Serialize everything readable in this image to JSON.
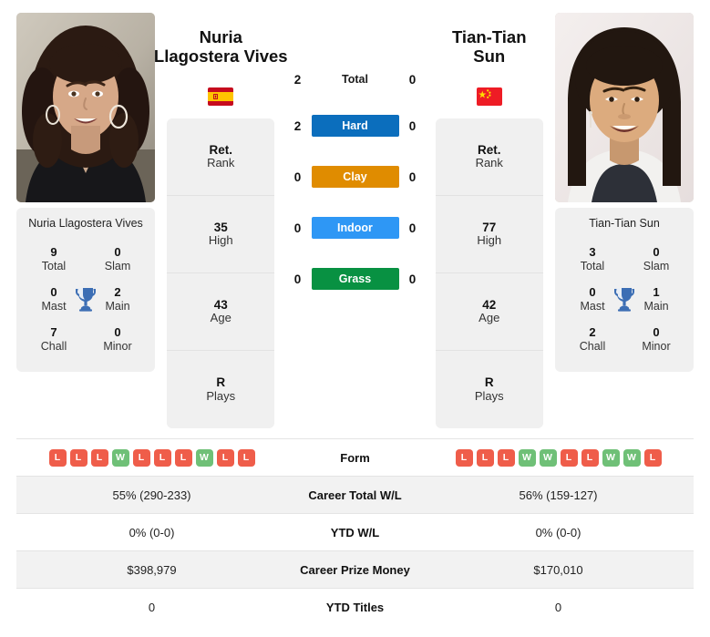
{
  "colors": {
    "hard": "#0b6ebd",
    "clay": "#e08c00",
    "indoor": "#2e97f5",
    "grass": "#089142",
    "win": "#6fc077",
    "loss": "#ef5d4a",
    "card_bg": "#f0f0f0",
    "row_shade": "#f2f2f2",
    "trophy": "#3c6eb4"
  },
  "players": {
    "left": {
      "photo_alt": "Nuria Llagostera Vives headshot",
      "name_line1": "Nuria",
      "name_line2": "Llagostera Vives",
      "flag": "spain-flag",
      "card_name": "Nuria Llagostera Vives",
      "rank": {
        "value": "Ret.",
        "label": "Rank"
      },
      "high": {
        "value": "35",
        "label": "High"
      },
      "age": {
        "value": "43",
        "label": "Age"
      },
      "plays": {
        "value": "R",
        "label": "Plays"
      },
      "titles": {
        "total": {
          "value": "9",
          "label": "Total"
        },
        "slam": {
          "value": "0",
          "label": "Slam"
        },
        "mast": {
          "value": "0",
          "label": "Mast"
        },
        "main": {
          "value": "2",
          "label": "Main"
        },
        "chall": {
          "value": "7",
          "label": "Chall"
        },
        "minor": {
          "value": "0",
          "label": "Minor"
        }
      },
      "surface_wins": {
        "total": "2",
        "hard": "2",
        "clay": "0",
        "indoor": "0",
        "grass": "0"
      },
      "form": [
        "L",
        "L",
        "L",
        "W",
        "L",
        "L",
        "L",
        "W",
        "L",
        "L"
      ],
      "career_total_wl": "55% (290-233)",
      "ytd_wl": "0% (0-0)",
      "career_prize_money": "$398,979",
      "ytd_titles": "0"
    },
    "right": {
      "photo_alt": "Tian-Tian Sun headshot",
      "name_line1": "Tian-Tian",
      "name_line2": "Sun",
      "flag": "china-flag",
      "card_name": "Tian-Tian Sun",
      "rank": {
        "value": "Ret.",
        "label": "Rank"
      },
      "high": {
        "value": "77",
        "label": "High"
      },
      "age": {
        "value": "42",
        "label": "Age"
      },
      "plays": {
        "value": "R",
        "label": "Plays"
      },
      "titles": {
        "total": {
          "value": "3",
          "label": "Total"
        },
        "slam": {
          "value": "0",
          "label": "Slam"
        },
        "mast": {
          "value": "0",
          "label": "Mast"
        },
        "main": {
          "value": "1",
          "label": "Main"
        },
        "chall": {
          "value": "2",
          "label": "Chall"
        },
        "minor": {
          "value": "0",
          "label": "Minor"
        }
      },
      "surface_wins": {
        "total": "0",
        "hard": "0",
        "clay": "0",
        "indoor": "0",
        "grass": "0"
      },
      "form": [
        "L",
        "L",
        "L",
        "W",
        "W",
        "L",
        "L",
        "W",
        "W",
        "L"
      ],
      "career_total_wl": "56% (159-127)",
      "ytd_wl": "0% (0-0)",
      "career_prize_money": "$170,010",
      "ytd_titles": "0"
    }
  },
  "surfaces": [
    {
      "key": "total",
      "label": "Total",
      "style": "plain"
    },
    {
      "key": "hard",
      "label": "Hard",
      "style": "hard"
    },
    {
      "key": "clay",
      "label": "Clay",
      "style": "clay"
    },
    {
      "key": "indoor",
      "label": "Indoor",
      "style": "indoor"
    },
    {
      "key": "grass",
      "label": "Grass",
      "style": "grass"
    }
  ],
  "table_labels": {
    "form": "Form",
    "career_total_wl": "Career Total W/L",
    "ytd_wl": "YTD W/L",
    "career_prize_money": "Career Prize Money",
    "ytd_titles": "YTD Titles"
  }
}
